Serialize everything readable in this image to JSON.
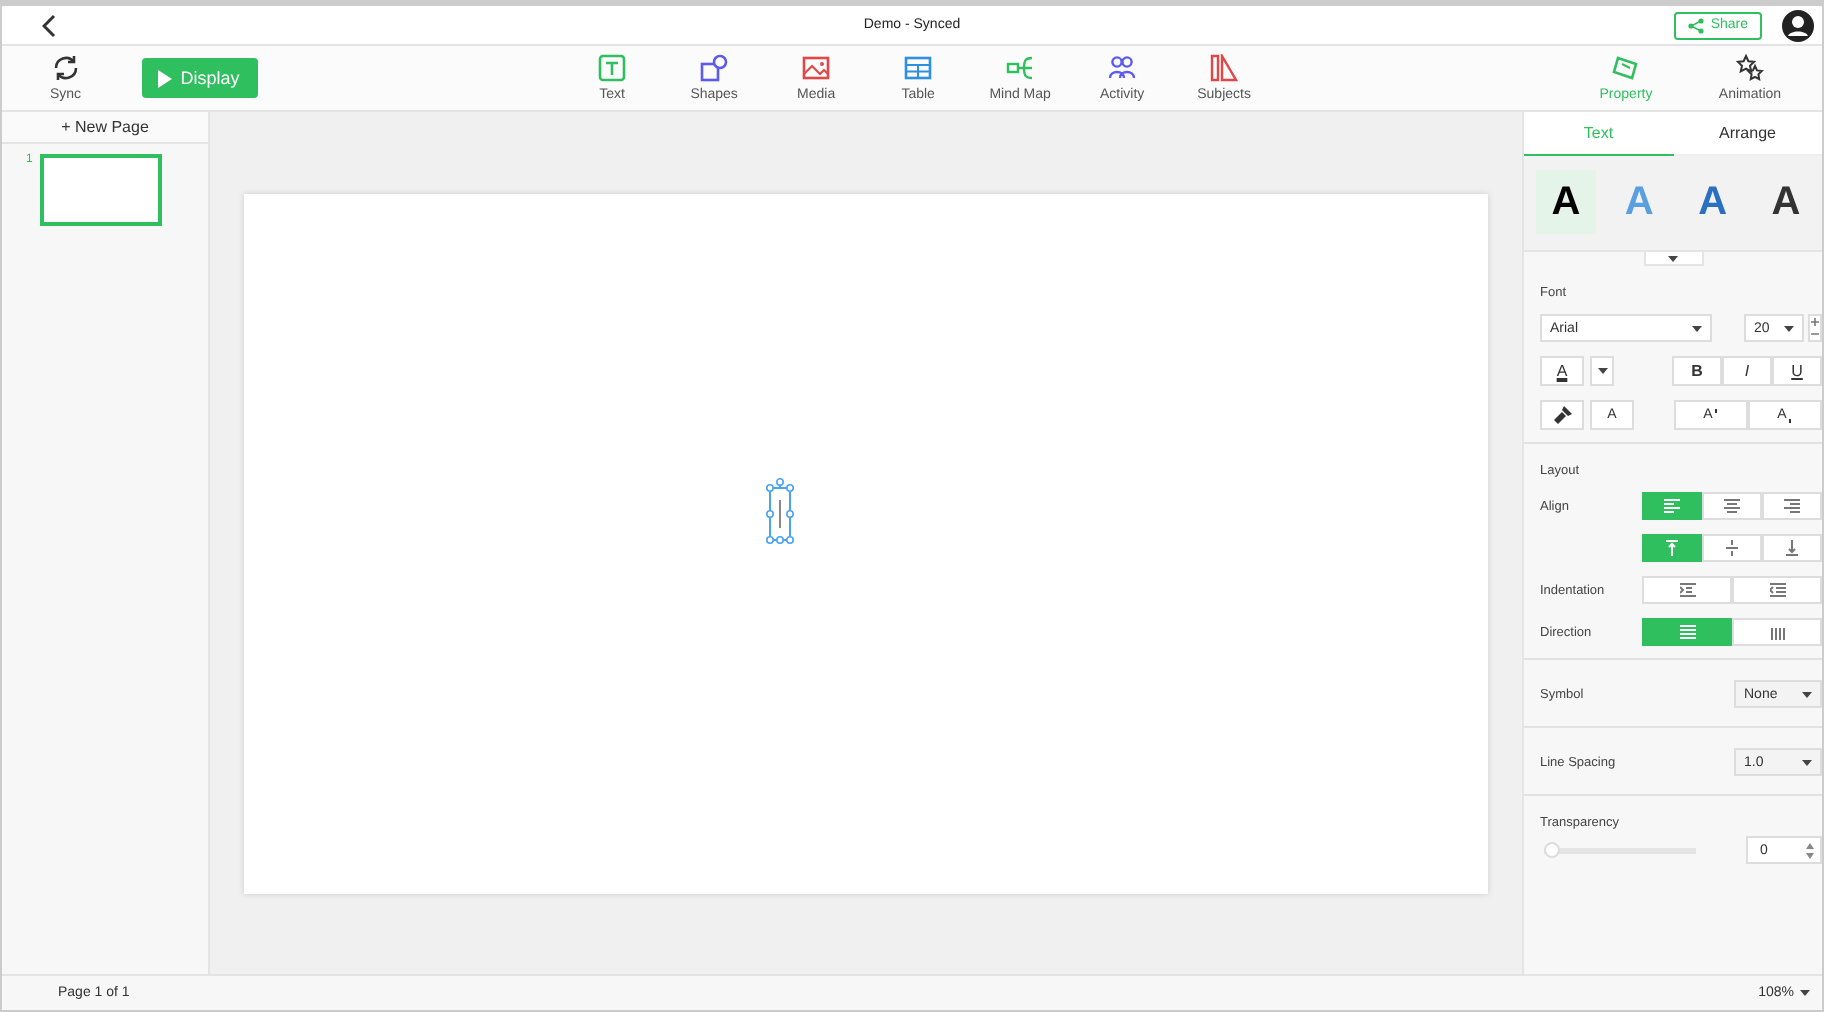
{
  "window": {
    "title": "Demo - Synced",
    "share": "Share"
  },
  "toolbar": {
    "sync": "Sync",
    "display": "Display",
    "tools": [
      {
        "kind": "text",
        "label": "Text"
      },
      {
        "kind": "shapes",
        "label": "Shapes"
      },
      {
        "kind": "media",
        "label": "Media"
      },
      {
        "kind": "table",
        "label": "Table"
      },
      {
        "kind": "mindmap",
        "label": "Mind Map"
      },
      {
        "kind": "activity",
        "label": "Activity"
      },
      {
        "kind": "subjects",
        "label": "Subjects"
      }
    ],
    "panel_tabs": [
      {
        "kind": "property",
        "label": "Property",
        "selected": true
      },
      {
        "kind": "animation",
        "label": "Animation",
        "selected": false
      }
    ]
  },
  "pages": {
    "new_page": "+ New Page",
    "thumbnails": [
      {
        "number": "1",
        "selected": true
      }
    ]
  },
  "panel": {
    "tabs": [
      {
        "label": "Text",
        "selected": true
      },
      {
        "label": "Arrange",
        "selected": false
      }
    ],
    "styles": [
      {
        "kind": "solid",
        "letter": "A",
        "selected": true
      },
      {
        "kind": "light",
        "letter": "A",
        "selected": false
      },
      {
        "kind": "blue",
        "letter": "A",
        "selected": false
      },
      {
        "kind": "dark",
        "letter": "A",
        "selected": false
      }
    ],
    "font_label": "Font",
    "font": "Arial",
    "size": "20",
    "color_letter": "A",
    "styles_buttons": [
      {
        "kind": "bold",
        "label": "B"
      },
      {
        "kind": "italic",
        "label": "I"
      },
      {
        "kind": "underline",
        "label": "U"
      }
    ],
    "clear_letter": "A",
    "script_buttons": [
      {
        "kind": "super",
        "label": "A"
      },
      {
        "kind": "sub",
        "label": "A"
      }
    ],
    "layout_label": "Layout",
    "align_label": "Align",
    "align": [
      {
        "kind": "left",
        "selected": true
      },
      {
        "kind": "center",
        "selected": false
      },
      {
        "kind": "right",
        "selected": false
      }
    ],
    "valign": [
      {
        "kind": "top",
        "selected": true
      },
      {
        "kind": "middle",
        "selected": false
      },
      {
        "kind": "bottom",
        "selected": false
      }
    ],
    "indent_label": "Indentation",
    "indent": [
      {
        "kind": "increase"
      },
      {
        "kind": "decrease"
      }
    ],
    "direction_label": "Direction",
    "direction": [
      {
        "kind": "horizontal",
        "selected": true
      },
      {
        "kind": "vertical",
        "selected": false
      }
    ],
    "symbol_label": "Symbol",
    "symbol": "None",
    "spacing_label": "Line Spacing",
    "spacing": "1.0",
    "transparency_label": "Transparency",
    "transparency": {
      "level": 0,
      "value": "0"
    }
  },
  "status_bar": {
    "page": "Page 1 of 1",
    "zoom": "108%"
  }
}
